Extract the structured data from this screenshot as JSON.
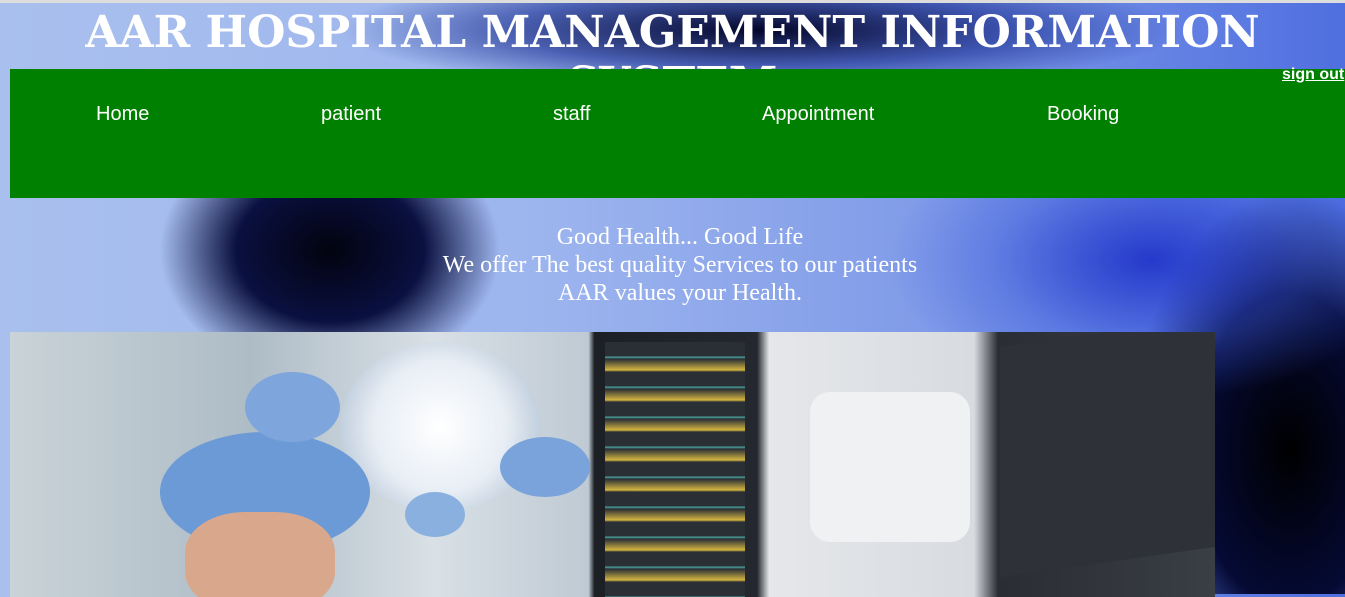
{
  "header": {
    "title": "AAR HOSPITAL MANAGEMENT INFORMATION SYSTEM"
  },
  "nav": {
    "items": [
      {
        "label": "Home"
      },
      {
        "label": "patient"
      },
      {
        "label": "staff"
      },
      {
        "label": "Appointment"
      },
      {
        "label": "Booking"
      }
    ],
    "sign_out": "sign out"
  },
  "tagline": {
    "line1": "Good Health... Good Life",
    "line2": "We offer The best quality Services to our patients",
    "line3": "AAR values your Health."
  },
  "colors": {
    "nav_bg": "#008000",
    "text": "#ffffff"
  }
}
